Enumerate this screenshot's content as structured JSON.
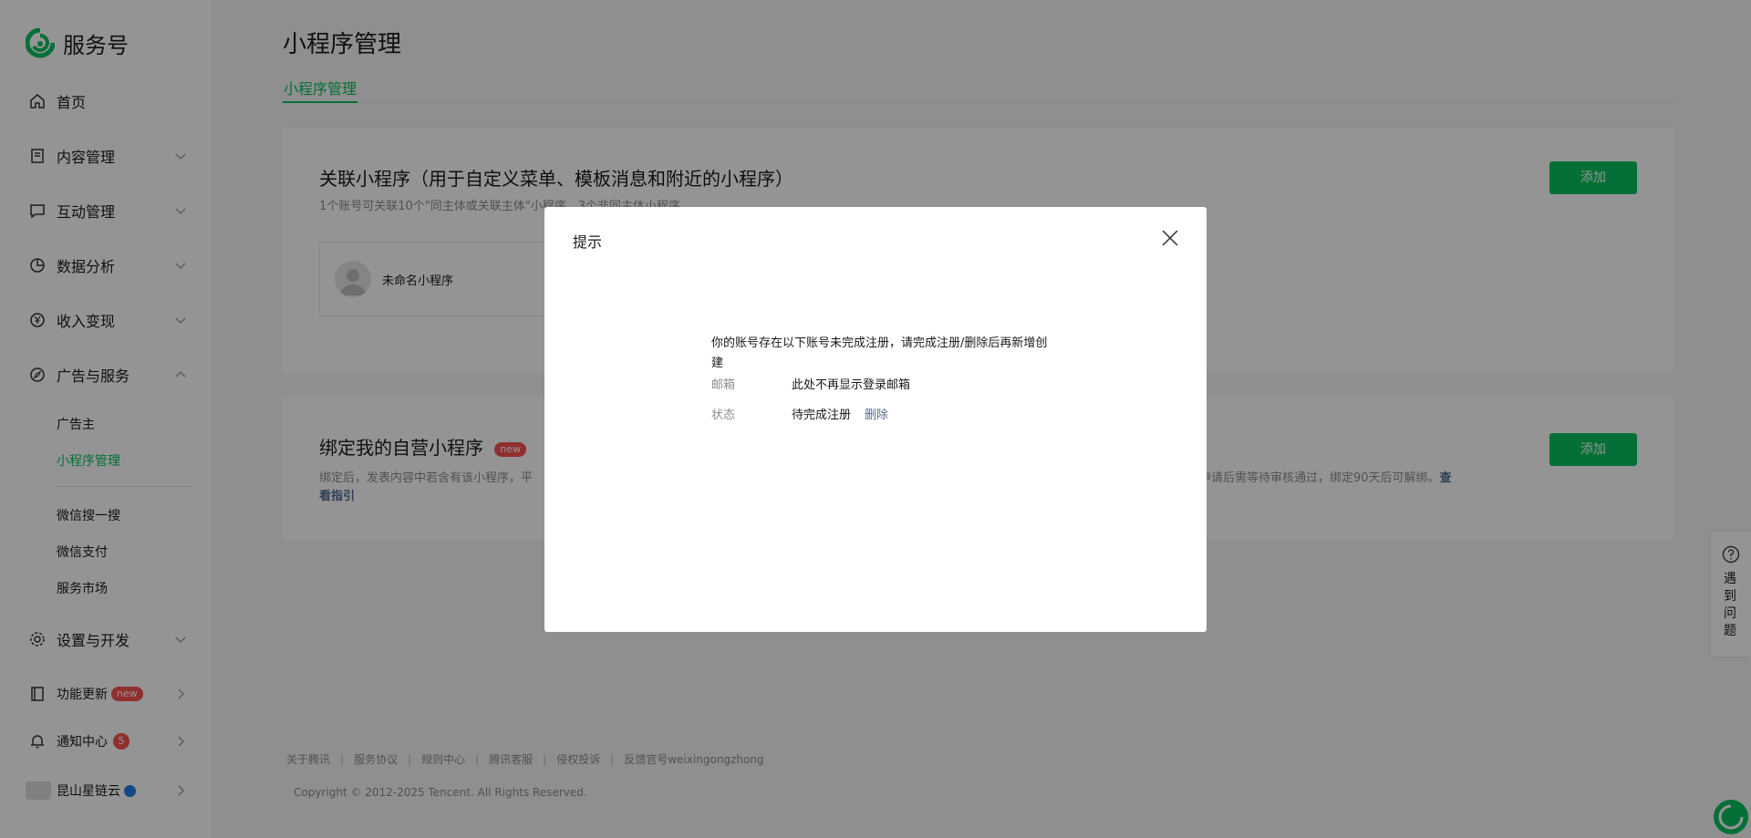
{
  "brand": {
    "name": "服务号"
  },
  "sidebar": {
    "items": [
      {
        "label": "首页"
      },
      {
        "label": "内容管理"
      },
      {
        "label": "互动管理"
      },
      {
        "label": "数据分析"
      },
      {
        "label": "收入变现"
      },
      {
        "label": "广告与服务"
      },
      {
        "label": "设置与开发"
      },
      {
        "label": "功能更新",
        "badge": "new"
      },
      {
        "label": "通知中心",
        "badge": "5"
      }
    ],
    "sub_items": [
      {
        "label": "广告主"
      },
      {
        "label": "小程序管理"
      },
      {
        "label": "微信搜一搜"
      },
      {
        "label": "微信支付"
      },
      {
        "label": "服务市场"
      }
    ],
    "account": {
      "name": "昆山星链云"
    }
  },
  "main": {
    "title": "小程序管理",
    "tabs": [
      {
        "label": "小程序管理"
      }
    ],
    "linked_section": {
      "title": "关联小程序（用于自定义菜单、模板消息和附近的小程序）",
      "desc": "1个账号可关联10个\"同主体或关联主体\"小程序，3个非同主体小程序。",
      "add_label": "添加",
      "item_name": "未命名小程序"
    },
    "bind_section": {
      "title": "绑定我的自营小程序",
      "badge": "new",
      "desc_left": "绑定后，发表内容中若含有该小程序，平",
      "desc_right": "申请后需等待审核通过，绑定90天后可解绑。",
      "link_part1": "查",
      "link_part2": "看指引",
      "add_label": "添加"
    }
  },
  "footer": {
    "links": [
      "关于腾讯",
      "服务协议",
      "规则中心",
      "腾讯客服",
      "侵权投诉",
      "反馈官号weixingongzhong"
    ],
    "copyright": "Copyright © 2012-2025 Tencent. All Rights Reserved."
  },
  "help": {
    "label": "遇到问题"
  },
  "dialog": {
    "title": "提示",
    "message": "你的账号存在以下账号未完成注册，请完成注册/删除后再新增创建",
    "email_label": "邮箱",
    "email_value": "此处不再显示登录邮箱",
    "status_label": "状态",
    "status_value": "待完成注册",
    "delete_label": "删除"
  },
  "colors": {
    "accent": "#07c160",
    "link": "#576b95",
    "badge": "#fa5151"
  }
}
